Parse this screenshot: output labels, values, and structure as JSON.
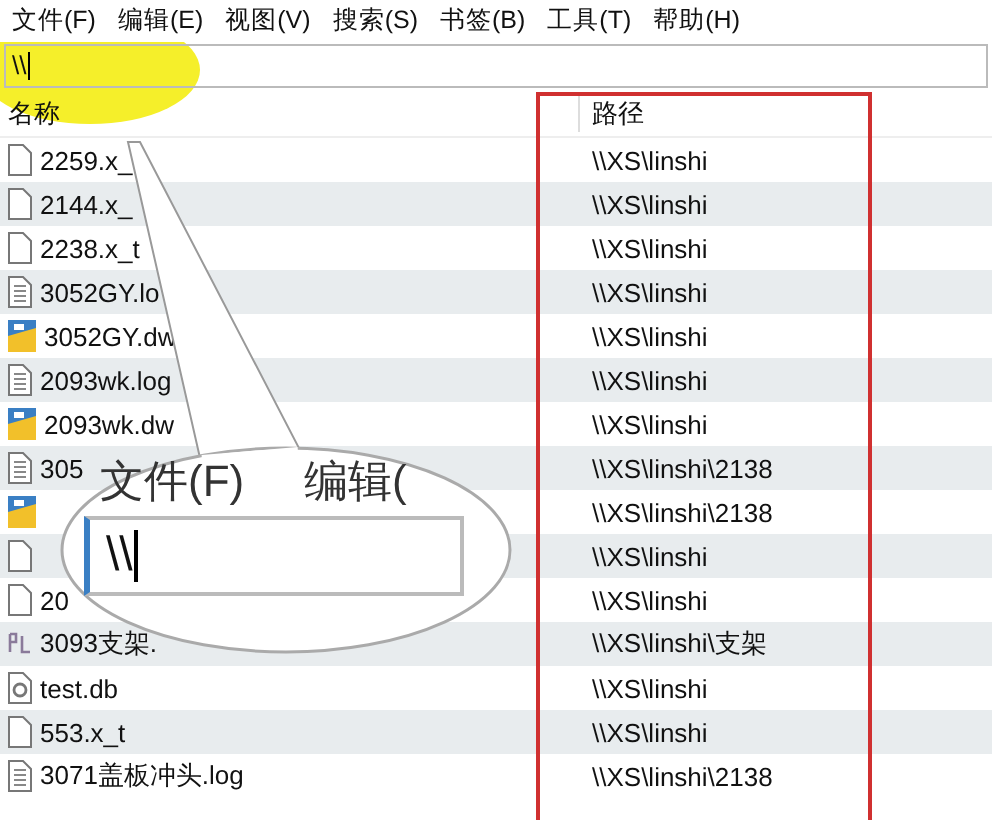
{
  "menu": [
    "文件(F)",
    "编辑(E)",
    "视图(V)",
    "搜索(S)",
    "书签(B)",
    "工具(T)",
    "帮助(H)"
  ],
  "search": {
    "value": "\\\\"
  },
  "table": {
    "columns": [
      "名称",
      "路径"
    ],
    "rows": [
      {
        "kind": "blank",
        "name": "2259.x_",
        "path": "\\\\XS\\linshi"
      },
      {
        "kind": "blank",
        "name": "2144.x_",
        "path": "\\\\XS\\linshi"
      },
      {
        "kind": "blank",
        "name": "2238.x_t",
        "path": "\\\\XS\\linshi"
      },
      {
        "kind": "text",
        "name": "3052GY.lo",
        "path": "\\\\XS\\linshi"
      },
      {
        "kind": "dwg",
        "name": "3052GY.dw",
        "path": "\\\\XS\\linshi"
      },
      {
        "kind": "text",
        "name": "2093wk.log",
        "path": "\\\\XS\\linshi"
      },
      {
        "kind": "dwg",
        "name": "2093wk.dw",
        "path": "\\\\XS\\linshi"
      },
      {
        "kind": "text",
        "name": "305",
        "path": "\\\\XS\\linshi\\2138"
      },
      {
        "kind": "dwg",
        "path": "\\\\XS\\linshi\\2138"
      },
      {
        "kind": "blank",
        "path": "\\\\XS\\linshi"
      },
      {
        "kind": "blank",
        "name": "20",
        "path": "\\\\XS\\linshi"
      },
      {
        "kind": "sld",
        "name": "3093支架.",
        "path": "\\\\XS\\linshi\\支架"
      },
      {
        "kind": "db",
        "name": "test.db",
        "path": "\\\\XS\\linshi"
      },
      {
        "kind": "blank",
        "name": "553.x_t",
        "path": "\\\\XS\\linshi"
      },
      {
        "kind": "text",
        "name": "3071盖板冲头.log",
        "path": "\\\\XS\\linshi\\2138"
      }
    ]
  },
  "callout": {
    "menu": [
      "文件(F)",
      "编辑("
    ],
    "value": "\\\\"
  }
}
